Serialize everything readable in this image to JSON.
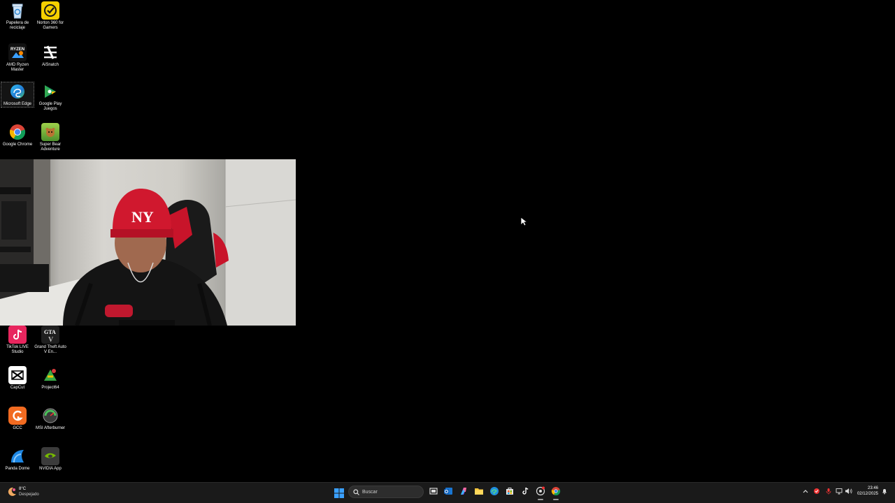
{
  "desktop": {
    "icons_top": [
      {
        "name": "recycle-bin",
        "label": "Papelera de reciclaje",
        "icon": "recycle-bin-icon"
      },
      {
        "name": "norton-360",
        "label": "Norton 360 for Gamers",
        "icon": "norton-icon"
      },
      {
        "name": "amd-ryzen-master",
        "label": "AMD Ryzen Master",
        "icon": "amd-ryzen-icon"
      },
      {
        "name": "aisnatch",
        "label": "AiSnatch",
        "icon": "aisnatch-icon"
      },
      {
        "name": "microsoft-edge",
        "label": "Microsoft Edge",
        "icon": "edge-icon"
      },
      {
        "name": "google-play-juegos",
        "label": "Google Play Juegos",
        "icon": "google-play-icon"
      },
      {
        "name": "google-chrome",
        "label": "Google Chrome",
        "icon": "chrome-icon"
      },
      {
        "name": "super-bear-adventure",
        "label": "Super Bear Adventure",
        "icon": "super-bear-icon"
      }
    ],
    "icons_bottom": [
      {
        "name": "tiktok-live-studio",
        "label": "TikTok LIVE Studio",
        "icon": "tiktok-icon"
      },
      {
        "name": "gta-v",
        "label": "Grand Theft Auto V En...",
        "icon": "gta-icon"
      },
      {
        "name": "capcut",
        "label": "CapCut",
        "icon": "capcut-icon"
      },
      {
        "name": "project64",
        "label": "Project64",
        "icon": "project64-icon"
      },
      {
        "name": "gcc",
        "label": "GCC",
        "icon": "gcc-icon"
      },
      {
        "name": "msi-afterburner",
        "label": "MSI Afterburner",
        "icon": "msi-afterburner-icon"
      },
      {
        "name": "panda-dome",
        "label": "Panda Dome",
        "icon": "panda-dome-icon"
      },
      {
        "name": "nvidia-app",
        "label": "NVIDIA App",
        "icon": "nvidia-icon"
      }
    ]
  },
  "webcam": {
    "cap_text": "NY"
  },
  "taskbar": {
    "weather_temp": "8°C",
    "weather_desc": "Despejado",
    "search_placeholder": "Buscar",
    "time": "23:46",
    "date": "02/12/2025"
  },
  "colors": {
    "taskbar_bg": "#1a1a1a",
    "desktop_bg": "#000000",
    "cap_red": "#d0182e"
  }
}
